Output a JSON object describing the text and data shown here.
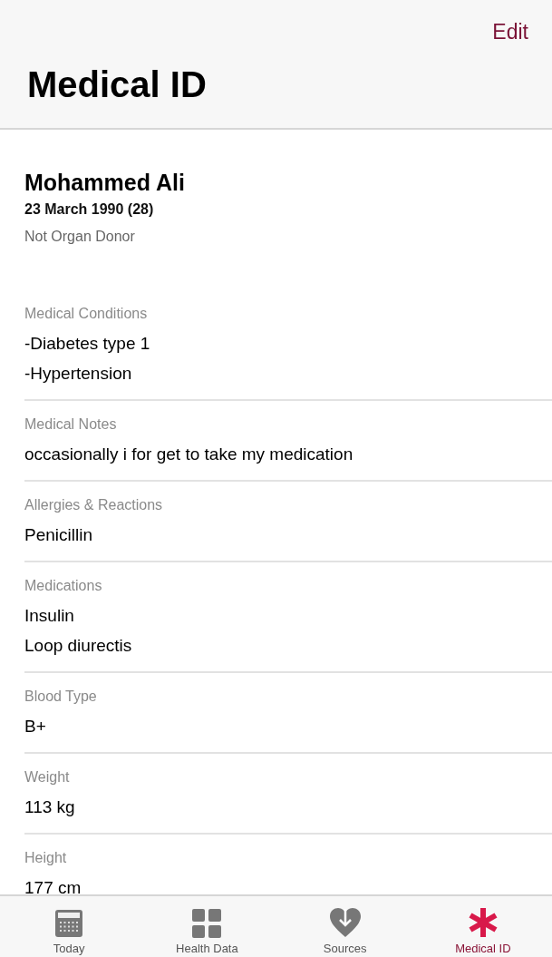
{
  "header": {
    "edit": "Edit",
    "title": "Medical ID"
  },
  "profile": {
    "name": "Mohammed Ali",
    "birth": "23 March 1990 (28)",
    "donor": "Not Organ Donor"
  },
  "sections": [
    {
      "label": "Medical Conditions",
      "values": [
        "-Diabetes type 1",
        "-Hypertension"
      ]
    },
    {
      "label": "Medical Notes",
      "values": [
        "occasionally i for get to take my medication"
      ]
    },
    {
      "label": "Allergies & Reactions",
      "values": [
        "Penicillin"
      ]
    },
    {
      "label": "Medications",
      "values": [
        "Insulin",
        "Loop diurectis"
      ]
    },
    {
      "label": "Blood Type",
      "values": [
        "B+"
      ]
    },
    {
      "label": "Weight",
      "values": [
        "113 kg"
      ]
    },
    {
      "label": "Height",
      "values": [
        "177 cm"
      ]
    }
  ],
  "tabs": [
    {
      "label": "Today",
      "kind": "calendar",
      "selected": false
    },
    {
      "label": "Health Data",
      "kind": "grid",
      "selected": false
    },
    {
      "label": "Sources",
      "kind": "heart",
      "selected": false
    },
    {
      "label": "Medical ID",
      "kind": "asterisk",
      "selected": true
    }
  ]
}
